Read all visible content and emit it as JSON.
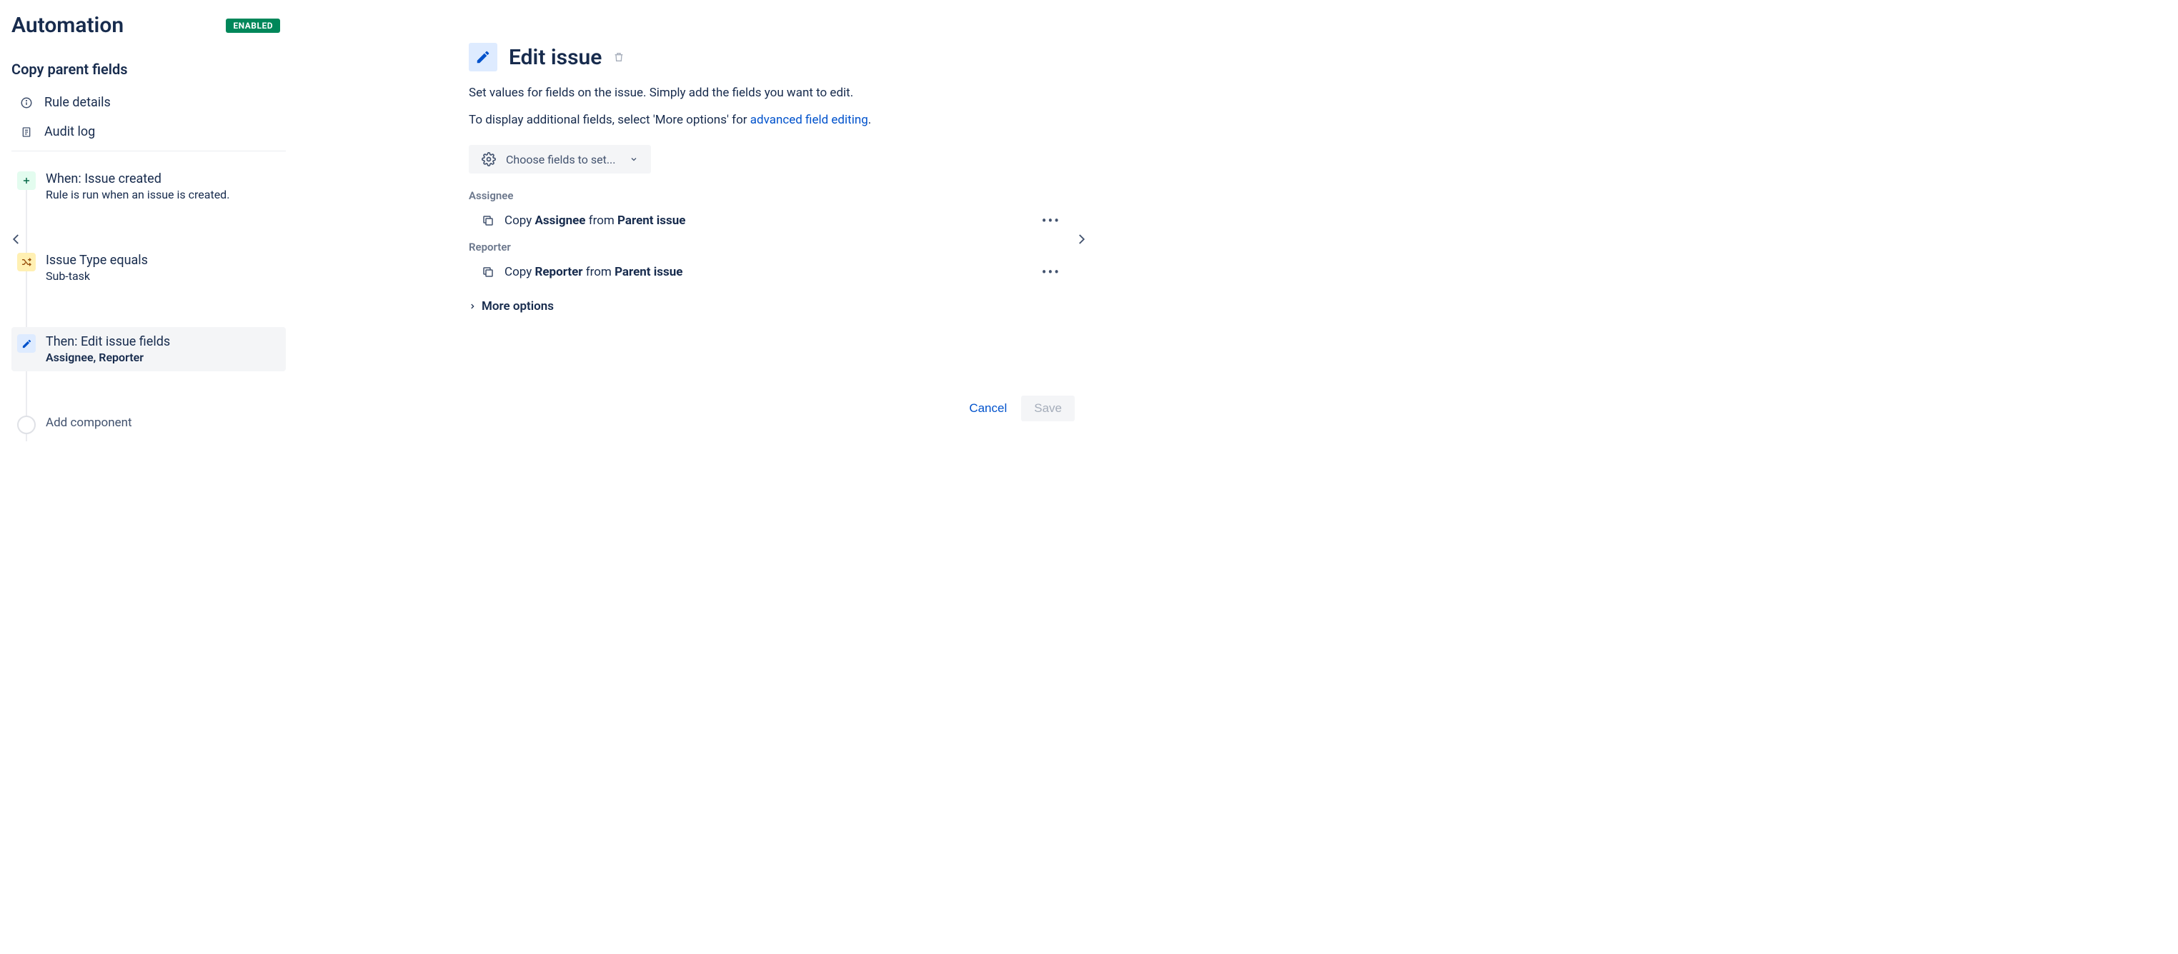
{
  "header": {
    "title": "Automation",
    "status_badge": "ENABLED"
  },
  "sidebar": {
    "rule_name": "Copy parent fields",
    "nav": [
      {
        "label": "Rule details",
        "icon": "info"
      },
      {
        "label": "Audit log",
        "icon": "log"
      }
    ],
    "steps": {
      "trigger": {
        "title": "When: Issue created",
        "subtitle": "Rule is run when an issue is created."
      },
      "condition": {
        "title": "Issue Type equals",
        "subtitle": "Sub-task"
      },
      "action": {
        "title": "Then: Edit issue fields",
        "fields_label": "Assignee, Reporter"
      },
      "add": {
        "title": "Add component"
      }
    }
  },
  "panel": {
    "title": "Edit issue",
    "description_1": "Set values for fields on the issue. Simply add the fields you want to edit.",
    "description_2_prefix": "To display additional fields, select 'More options' for ",
    "description_2_link": "advanced field editing",
    "description_2_suffix": ".",
    "choose_fields_label": "Choose fields to set...",
    "fields": [
      {
        "label": "Assignee",
        "action_prefix": "Copy ",
        "action_field": "Assignee",
        "action_mid": " from ",
        "action_source": "Parent issue"
      },
      {
        "label": "Reporter",
        "action_prefix": "Copy ",
        "action_field": "Reporter",
        "action_mid": " from ",
        "action_source": "Parent issue"
      }
    ],
    "more_options_label": "More options",
    "cancel_label": "Cancel",
    "save_label": "Save"
  }
}
